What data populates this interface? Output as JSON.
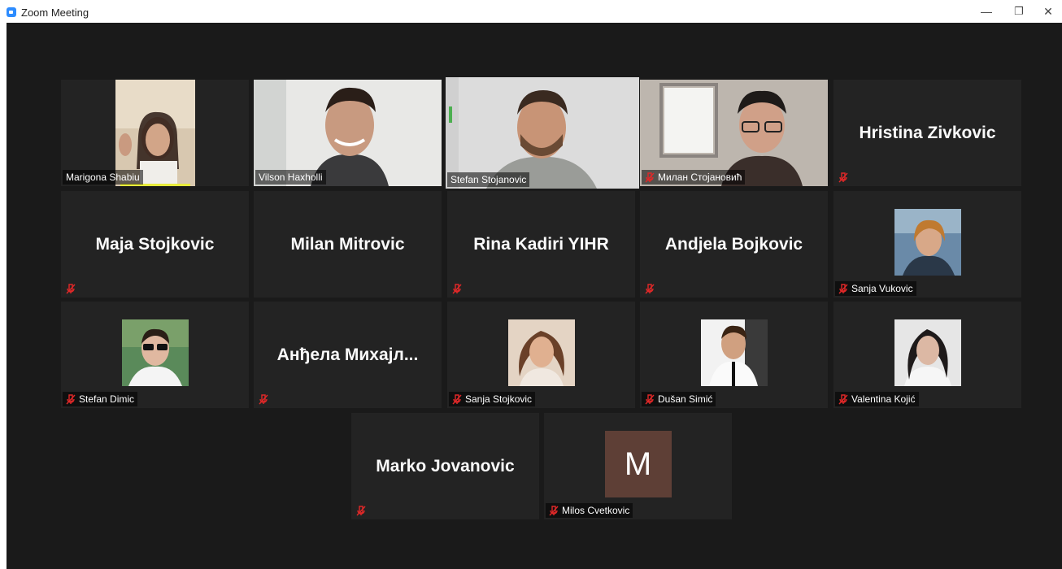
{
  "window": {
    "title": "Zoom Meeting",
    "minimize_glyph": "—",
    "restore_glyph": "❐",
    "close_glyph": "✕",
    "accent": "#2d8cff"
  },
  "participants": [
    {
      "name": "Marigona Shabiu",
      "muted": false,
      "video": true
    },
    {
      "name": "Vilson Haxholli",
      "muted": false,
      "video": true
    },
    {
      "name": "Stefan Stojanovic",
      "muted": false,
      "video": true,
      "active_speaker": true
    },
    {
      "name": "Милан Стојановић",
      "muted": true,
      "video": true
    },
    {
      "name": "Hristina Zivkovic",
      "muted": true,
      "video": false
    },
    {
      "name": "Maja Stojkovic",
      "muted": true,
      "video": false
    },
    {
      "name": "Milan Mitrovic",
      "muted": false,
      "video": false
    },
    {
      "name": "Rina Kadiri YIHR",
      "muted": true,
      "video": false
    },
    {
      "name": "Andjela Bojkovic",
      "muted": true,
      "video": false
    },
    {
      "name": "Sanja Vukovic",
      "muted": true,
      "video": true
    },
    {
      "name": "Stefan Dimic",
      "muted": true,
      "video": true
    },
    {
      "name": "Анђела Михајл...",
      "muted": true,
      "video": false
    },
    {
      "name": "Sanja Stojkovic",
      "muted": true,
      "video": true
    },
    {
      "name": "Dušan Simić",
      "muted": true,
      "video": true
    },
    {
      "name": "Valentina Kojić",
      "muted": true,
      "video": true
    },
    {
      "name": "Marko Jovanovic",
      "muted": true,
      "video": false
    },
    {
      "name": "Milos Cvetkovic",
      "muted": true,
      "video": false,
      "avatar_letter": "M",
      "avatar_color": "#5e3f36"
    }
  ],
  "colors": {
    "stage_bg": "#1a1a1a",
    "tile_bg": "#232323",
    "active_speaker_border": "#e5eb7a",
    "mute_red": "#e02828"
  }
}
